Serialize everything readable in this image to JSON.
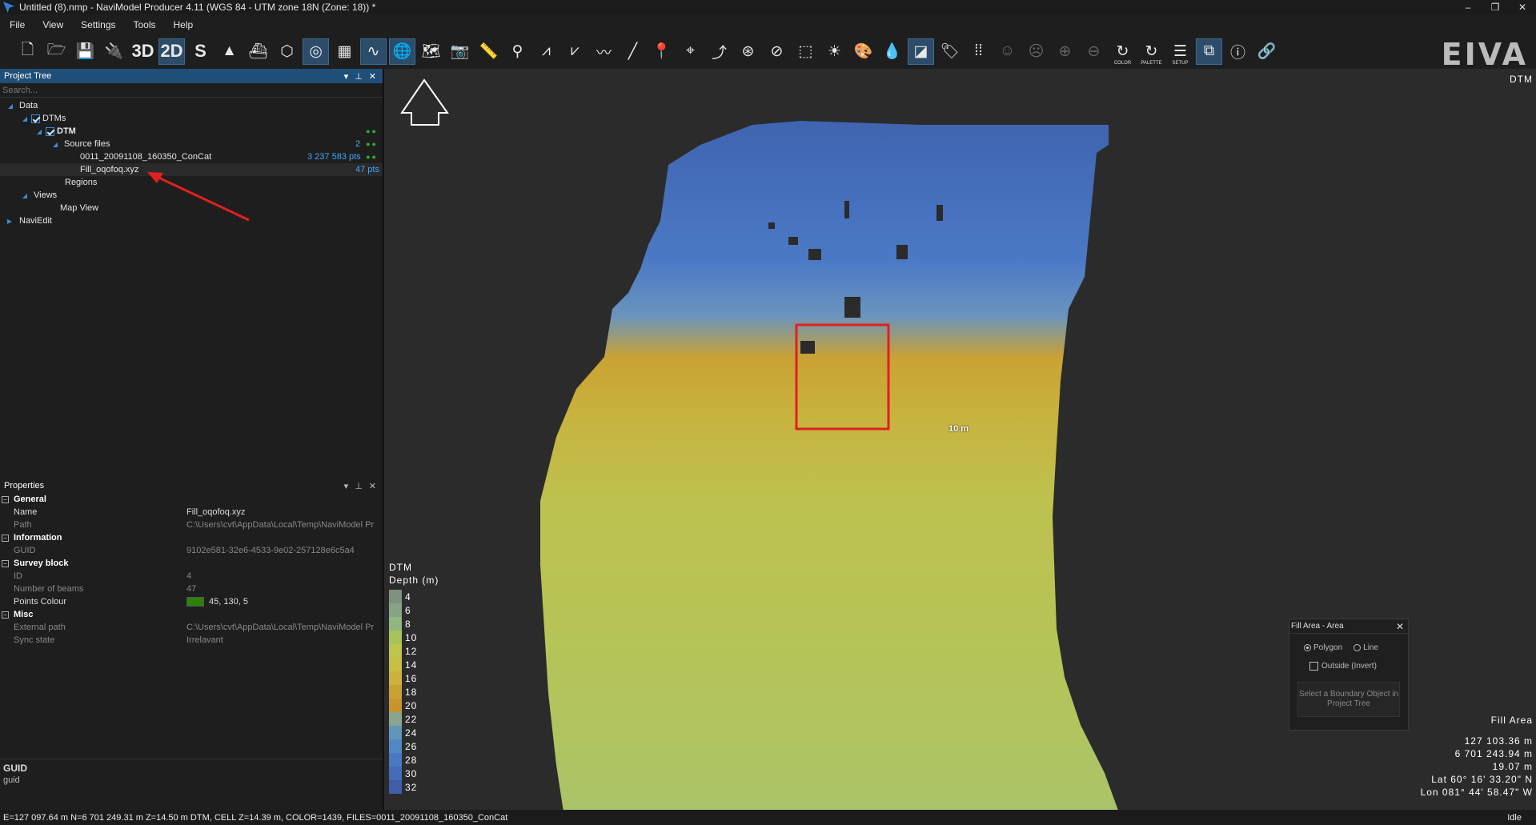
{
  "window": {
    "title": "Untitled (8).nmp - NaviModel Producer 4.11 (WGS 84 - UTM zone 18N (Zone: 18)) *",
    "controls": [
      "–",
      "❐",
      "✕"
    ]
  },
  "menu": [
    "File",
    "View",
    "Settings",
    "Tools",
    "Help"
  ],
  "toolbar": {
    "btn_3d": "3D",
    "btn_2d": "2D",
    "btn_s": "S",
    "color_label": "COLOR",
    "palette_label": "PALETTE",
    "setup_label": "SETUP",
    "logo": "EIVA"
  },
  "project_tree": {
    "title": "Project Tree",
    "search_placeholder": "Search...",
    "items": {
      "data": "Data",
      "dtms": "DTMs",
      "dtm": "DTM",
      "source_files": "Source files",
      "source_files_count": "2",
      "file1": "0011_20091108_160350_ConCat",
      "file1_pts": "3 237 583 pts",
      "file2": "Fill_oqofoq.xyz",
      "file2_pts": "47 pts",
      "regions": "Regions",
      "views": "Views",
      "map_view": "Map View",
      "naviedit": "NaviEdit"
    }
  },
  "properties": {
    "title": "Properties",
    "general": "General",
    "name_k": "Name",
    "name_v": "Fill_oqofoq.xyz",
    "path_k": "Path",
    "path_v": "C:\\Users\\cvt\\AppData\\Local\\Temp\\NaviModel Pr",
    "information": "Information",
    "guid_k": "GUID",
    "guid_v": "9102e581-32e6-4533-9e02-257128e6c5a4",
    "survey_block": "Survey block",
    "id_k": "ID",
    "id_v": "4",
    "beams_k": "Number of beams",
    "beams_v": "47",
    "colour_k": "Points Colour",
    "colour_v": "45, 130, 5",
    "misc": "Misc",
    "ext_k": "External path",
    "ext_v": "C:\\Users\\cvt\\AppData\\Local\\Temp\\NaviModel Pr",
    "sync_k": "Sync state",
    "sync_v": "Irrelavant",
    "points_colour_hex": "#2d8205"
  },
  "guid_panel": {
    "title": "GUID",
    "desc": "guid"
  },
  "map": {
    "label_tr": "DTM",
    "scale_label": "10 m",
    "legend_title1": "DTM",
    "legend_title2": "Depth (m)",
    "legend": [
      {
        "label": "4",
        "color": "#7f917f"
      },
      {
        "label": "6",
        "color": "#87a485"
      },
      {
        "label": "8",
        "color": "#92b67f"
      },
      {
        "label": "10",
        "color": "#a8c35e"
      },
      {
        "label": "12",
        "color": "#bec44f"
      },
      {
        "label": "14",
        "color": "#c8bf45"
      },
      {
        "label": "16",
        "color": "#ccb23d"
      },
      {
        "label": "18",
        "color": "#c9a233"
      },
      {
        "label": "20",
        "color": "#c69530"
      },
      {
        "label": "22",
        "color": "#8aa48e"
      },
      {
        "label": "24",
        "color": "#5f95b7"
      },
      {
        "label": "26",
        "color": "#5386c4"
      },
      {
        "label": "28",
        "color": "#4a78c2"
      },
      {
        "label": "30",
        "color": "#446bb6"
      },
      {
        "label": "32",
        "color": "#3f5ea8"
      }
    ],
    "coords": {
      "label": "Fill Area",
      "e": "127 103.36 m",
      "n": "6 701 243.94 m",
      "z": "19.07 m",
      "lat": "Lat 60° 16' 33.20\" N",
      "lon": "Lon 081° 44' 58.47\" W"
    }
  },
  "fill_area": {
    "title": "Fill Area - Area",
    "polygon": "Polygon",
    "line": "Line",
    "outside": "Outside (Invert)",
    "button": "Select a Boundary Object in Project Tree"
  },
  "status": {
    "text": "E=127 097.64 m N=6 701 249.31 m Z=14.50 m DTM, CELL Z=14.39 m, COLOR=1439, FILES=0011_20091108_160350_ConCat",
    "state": "Idle"
  }
}
